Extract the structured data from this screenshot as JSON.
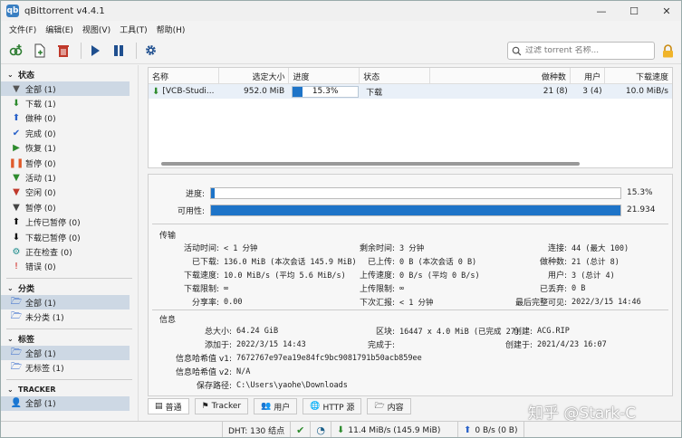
{
  "window": {
    "title": "qBittorrent v4.4.1",
    "app_icon": "qb",
    "minimize": "—",
    "maximize": "☐",
    "close": "✕"
  },
  "menu": [
    "文件(F)",
    "编辑(E)",
    "视图(V)",
    "工具(T)",
    "帮助(H)"
  ],
  "search": {
    "placeholder": "过滤 torrent 名称..."
  },
  "sidebar": {
    "status_title": "状态",
    "status_items": [
      {
        "label": "全部 (1)",
        "icon": "filter-icon",
        "glyph": "▼",
        "color": "#555"
      },
      {
        "label": "下载 (1)",
        "icon": "download-arrow-icon",
        "glyph": "⬇",
        "color": "#2e8b2e"
      },
      {
        "label": "做种 (0)",
        "icon": "upload-arrow-icon",
        "glyph": "⬆",
        "color": "#2a62c9"
      },
      {
        "label": "完成 (0)",
        "icon": "check-icon",
        "glyph": "✔",
        "color": "#2a62c9"
      },
      {
        "label": "恢复 (1)",
        "icon": "play-icon",
        "glyph": "▶",
        "color": "#2e8b2e"
      },
      {
        "label": "暂停 (0)",
        "icon": "pause-icon",
        "glyph": "❚❚",
        "color": "#e05a2a"
      },
      {
        "label": "活动 (1)",
        "icon": "filter-active-icon",
        "glyph": "▼",
        "color": "#2e8b2e"
      },
      {
        "label": "空闲 (0)",
        "icon": "filter-idle-icon",
        "glyph": "▼",
        "color": "#c0392b"
      },
      {
        "label": "暂停 (0)",
        "icon": "filter-stalled-icon",
        "glyph": "▼",
        "color": "#444"
      },
      {
        "label": "上传已暂停 (0)",
        "icon": "upload-stalled-icon",
        "glyph": "⬆",
        "color": "#111"
      },
      {
        "label": "下载已暂停 (0)",
        "icon": "download-stalled-icon",
        "glyph": "⬇",
        "color": "#111"
      },
      {
        "label": "正在检查 (0)",
        "icon": "gear-checking-icon",
        "glyph": "⚙",
        "color": "#1a8a8a"
      },
      {
        "label": "错误 (0)",
        "icon": "error-icon",
        "glyph": "!",
        "color": "#d0201a"
      }
    ],
    "category_title": "分类",
    "category_items": [
      {
        "label": "全部 (1)",
        "icon": "folder-icon",
        "glyph": "🗁",
        "color": "#2a62c9"
      },
      {
        "label": "未分类 (1)",
        "icon": "folder-icon",
        "glyph": "🗁",
        "color": "#2a62c9"
      }
    ],
    "tag_title": "标签",
    "tag_items": [
      {
        "label": "全部 (1)",
        "icon": "folder-icon",
        "glyph": "🗁",
        "color": "#2a62c9"
      },
      {
        "label": "无标签 (1)",
        "icon": "folder-icon",
        "glyph": "🗁",
        "color": "#2a62c9"
      }
    ],
    "tracker_title": "TRACKER",
    "tracker_items": [
      {
        "label": "全部 (1)",
        "icon": "person-icon",
        "glyph": "👤",
        "color": "#3a6ea5"
      }
    ]
  },
  "torrent_table": {
    "columns": [
      "名称",
      "选定大小",
      "进度",
      "状态",
      "做种数",
      "用户",
      "下载速度"
    ],
    "rows": [
      {
        "name": "[VCB-Studi...",
        "size": "952.0 MiB",
        "progress": 0.153,
        "progress_label": "15.3%",
        "status": "下载",
        "seeds": "21 (8)",
        "peers": "3 (4)",
        "dl_speed": "10.0 MiB/s"
      }
    ]
  },
  "details": {
    "progress_label": "进度:",
    "progress_value": "15.3%",
    "progress_fraction": 0.153,
    "availability_label": "可用性:",
    "availability_value": "21.934",
    "availability_fraction": 1.0,
    "transfer_title": "传输",
    "transfer": [
      {
        "k": "活动时间:",
        "v": "< 1 分钟"
      },
      {
        "k": "剩余时间:",
        "v": "3 分钟"
      },
      {
        "k": "连接:",
        "v": "44 (最大 100)"
      },
      {
        "k": "已下载:",
        "v": "136.0 MiB (本次会话 145.9 MiB)"
      },
      {
        "k": "已上传:",
        "v": "0 B (本次会话 0 B)"
      },
      {
        "k": "做种数:",
        "v": "21 (总计 8)"
      },
      {
        "k": "下载速度:",
        "v": "10.0 MiB/s (平均 5.6 MiB/s)"
      },
      {
        "k": "上传速度:",
        "v": "0 B/s (平均 0 B/s)"
      },
      {
        "k": "用户:",
        "v": "3 (总计 4)"
      },
      {
        "k": "下载限制:",
        "v": "∞"
      },
      {
        "k": "上传限制:",
        "v": "∞"
      },
      {
        "k": "已丢弃:",
        "v": "0 B"
      },
      {
        "k": "分享率:",
        "v": "0.00"
      },
      {
        "k": "下次汇报:",
        "v": "< 1 分钟"
      },
      {
        "k": "最后完整可见:",
        "v": "2022/3/15 14:46"
      }
    ],
    "info_title": "信息",
    "info": [
      {
        "k": "总大小:",
        "v": "64.24 GiB"
      },
      {
        "k": "区块:",
        "v": "16447 x 4.0 MiB (已完成 27)"
      },
      {
        "k": "创建:",
        "v": "ACG.RIP"
      },
      {
        "k": "添加于:",
        "v": "2022/3/15 14:43"
      },
      {
        "k": "完成于:",
        "v": ""
      },
      {
        "k": "创建于:",
        "v": "2021/4/23 16:07"
      },
      {
        "k": "信息哈希值 v1:",
        "v": "7672767e97ea19e84fc9bc9081791b50acb859ee"
      },
      {
        "k": "信息哈希值 v2:",
        "v": "N/A"
      },
      {
        "k": "保存路径:",
        "v": "C:\\Users\\yaohe\\Downloads"
      }
    ]
  },
  "tabs": [
    {
      "label": "普通",
      "icon": "general-icon",
      "glyph": "▤"
    },
    {
      "label": "Tracker",
      "icon": "tracker-icon",
      "glyph": "⚑"
    },
    {
      "label": "用户",
      "icon": "peers-icon",
      "glyph": "👥"
    },
    {
      "label": "HTTP 源",
      "icon": "http-icon",
      "glyph": "🌐"
    },
    {
      "label": "内容",
      "icon": "content-icon",
      "glyph": "🗁"
    }
  ],
  "statusbar": {
    "dht": "DHT: 130 结点",
    "dl": "11.4 MiB/s (145.9 MiB)",
    "ul": "0 B/s (0 B)"
  },
  "watermark": "知乎 @Stark-C",
  "colors": {
    "accent": "#1e74c8",
    "selection": "#cdd8e4",
    "row_highlight": "#e9f0f8"
  }
}
